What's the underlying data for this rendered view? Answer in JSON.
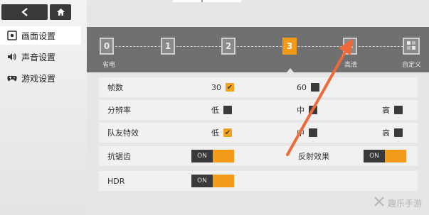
{
  "sidebar": {
    "items": [
      {
        "label": "画面设置",
        "icon": "display-settings-icon",
        "active": true
      },
      {
        "label": "声音设置",
        "icon": "speaker-icon",
        "active": false
      },
      {
        "label": "游戏设置",
        "icon": "gamepad-icon",
        "active": false
      }
    ]
  },
  "quality": {
    "steps": [
      "0",
      "1",
      "2",
      "3",
      "4"
    ],
    "active_step": "3",
    "label_left": "省电",
    "label_right_partial": "高清",
    "label_custom": "自定义"
  },
  "settings": {
    "fps": {
      "label": "帧数",
      "opt1": "30",
      "opt2": "60",
      "opt1_checked": true,
      "opt2_checked": false
    },
    "resolution": {
      "label": "分辨率",
      "low": "低",
      "mid": "中",
      "high": "高"
    },
    "teammate_fx": {
      "label": "队友特效",
      "low": "低",
      "mid": "中",
      "high": "高",
      "low_checked": true
    },
    "antialias": {
      "label": "抗锯齿",
      "toggle": "ON"
    },
    "reflection": {
      "label": "反射效果",
      "toggle": "ON"
    },
    "hdr": {
      "label": "HDR",
      "toggle": "ON"
    }
  },
  "watermark": {
    "text": "趣乐手游"
  },
  "colors": {
    "accent": "#f39a1a",
    "panel": "#707070",
    "arrow": "#ee6a3a"
  }
}
